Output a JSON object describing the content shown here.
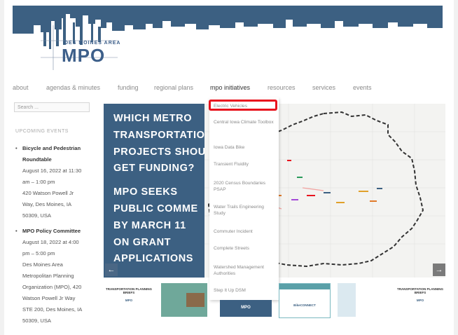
{
  "logo": {
    "small": "DES MOINES AREA",
    "big": "MPO"
  },
  "nav": {
    "items": [
      {
        "label": "about"
      },
      {
        "label": "agendas & minutes"
      },
      {
        "label": "funding"
      },
      {
        "label": "regional plans"
      },
      {
        "label": "mpo initiatives"
      },
      {
        "label": "resources"
      },
      {
        "label": "services"
      },
      {
        "label": "events"
      }
    ]
  },
  "search": {
    "placeholder": "Search ..."
  },
  "sidebar": {
    "events_title": "UPCOMING EVENTS",
    "events": [
      {
        "title_lines": [
          "Bicycle and Pedestrian",
          "Roundtable"
        ],
        "lines": [
          "August 16, 2022 at 11:30",
          "am – 1:00 pm",
          "420 Watson Powell Jr",
          "Way, Des Moines, IA",
          "50309, USA"
        ]
      },
      {
        "title_lines": [
          "MPO Policy Committee"
        ],
        "lines": [
          "August 18, 2022 at 4:00",
          "pm – 5:00 pm",
          "Des Moines Area",
          "Metropolitan Planning",
          "Organization (MPO), 420",
          "Watson Powell Jr Way",
          "STE 200, Des Moines, IA",
          "50309, USA"
        ]
      }
    ]
  },
  "slide": {
    "lines": [
      "WHICH METRO",
      "TRANSPORTATIO",
      "PROJECTS SHOU",
      "GET FUNDING?",
      "MPO SEEKS",
      "PUBLIC COMME",
      "BY MARCH 11",
      "ON GRANT",
      "APPLICATIONS"
    ],
    "prev": "←",
    "next": "→"
  },
  "dropdown": {
    "items": [
      {
        "label": "Electric Vehicles"
      },
      {
        "label": "Central Iowa Climate Toolbox"
      },
      {
        "label": "Iowa Data Bike"
      },
      {
        "label": "Transient Fluidity"
      },
      {
        "label": "2020 Census Boundaries PSAP"
      },
      {
        "label": "Water Trails Engineering Study"
      },
      {
        "label": "Commuter Incident"
      },
      {
        "label": "Complete Streets"
      },
      {
        "label": "Watershed Management Authorities"
      },
      {
        "label": "Step It Up DSM"
      }
    ]
  },
  "thumbs": {
    "t1": "TRANSPORTATION PLANNING BRIEFS",
    "t1b": "MPO",
    "t5": "MPO",
    "t6a": "BikeCONNECT",
    "t8": "TRANSPORTATION PLANNING BRIEFS",
    "t8b": "MPO"
  },
  "colors": {
    "accent": "#3c6082",
    "highlight": "#e8141e"
  }
}
